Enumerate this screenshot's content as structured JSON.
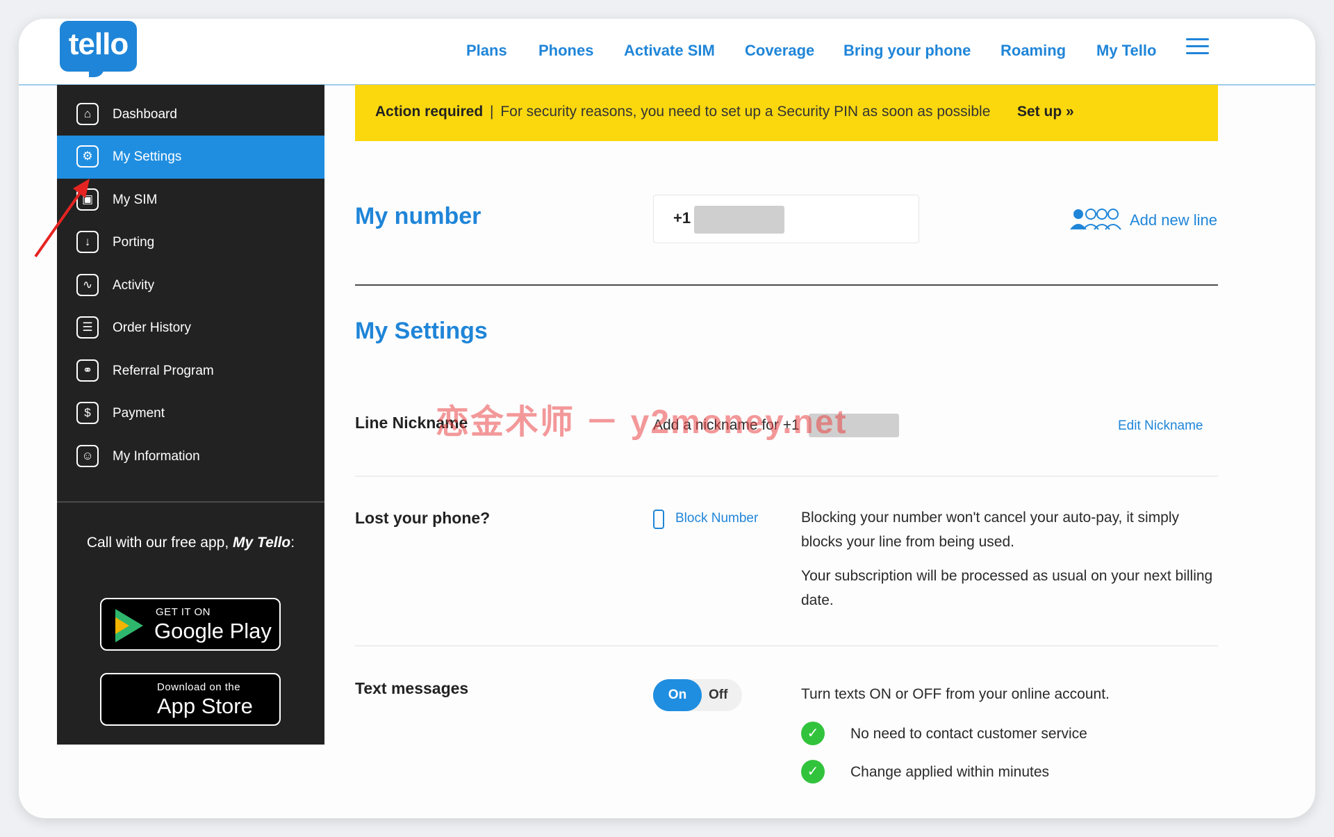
{
  "header": {
    "logo_text": "tello",
    "nav": [
      "Plans",
      "Phones",
      "Activate SIM",
      "Coverage",
      "Bring your phone",
      "Roaming",
      "My Tello"
    ]
  },
  "sidebar": {
    "items": [
      {
        "label": "Dashboard",
        "icon": "dashboard-icon",
        "glyph": "⌂"
      },
      {
        "label": "My Settings",
        "icon": "settings-icon",
        "glyph": "⚙"
      },
      {
        "label": "My SIM",
        "icon": "sim-icon",
        "glyph": "▣"
      },
      {
        "label": "Porting",
        "icon": "porting-icon",
        "glyph": "↓"
      },
      {
        "label": "Activity",
        "icon": "activity-icon",
        "glyph": "∿"
      },
      {
        "label": "Order History",
        "icon": "order-history-icon",
        "glyph": "☰"
      },
      {
        "label": "Referral Program",
        "icon": "referral-icon",
        "glyph": "⚭"
      },
      {
        "label": "Payment",
        "icon": "payment-icon",
        "glyph": "$"
      },
      {
        "label": "My Information",
        "icon": "user-icon",
        "glyph": "☺"
      }
    ],
    "active_index": 1,
    "promo_text_prefix": "Call with our free app,",
    "promo_app_name": "My Tello",
    "promo_suffix": ":",
    "google_play": {
      "small": "GET IT ON",
      "big": "Google Play"
    },
    "app_store": {
      "small": "Download on the",
      "big": "App Store"
    }
  },
  "banner": {
    "bold": "Action required",
    "separator": "|",
    "message": "For security reasons, you need to set up a Security PIN as soon as possible",
    "action": "Set up »"
  },
  "my_number": {
    "title": "My number",
    "prefix": "+1",
    "add_line_label": "Add new line"
  },
  "settings": {
    "title": "My Settings",
    "nickname": {
      "label": "Line Nickname",
      "value": "Add a nickname for +1",
      "edit": "Edit Nickname"
    },
    "lost_phone": {
      "label": "Lost your phone?",
      "action": "Block Number",
      "desc1": "Blocking your number won't cancel your auto-pay, it simply blocks your line from being used.",
      "desc2": "Your subscription will be processed as usual on your next billing date."
    },
    "text_messages": {
      "label": "Text messages",
      "on": "On",
      "off": "Off",
      "state": "on",
      "desc": "Turn texts ON or OFF from your online account.",
      "benefits": [
        "No need to contact customer service",
        "Change applied within minutes"
      ]
    }
  },
  "watermark": "恋金术师 － y2money.net",
  "colors": {
    "brand": "#1f85d8",
    "banner": "#fbd80e",
    "sidebar": "#222222",
    "check": "#32c33c"
  }
}
